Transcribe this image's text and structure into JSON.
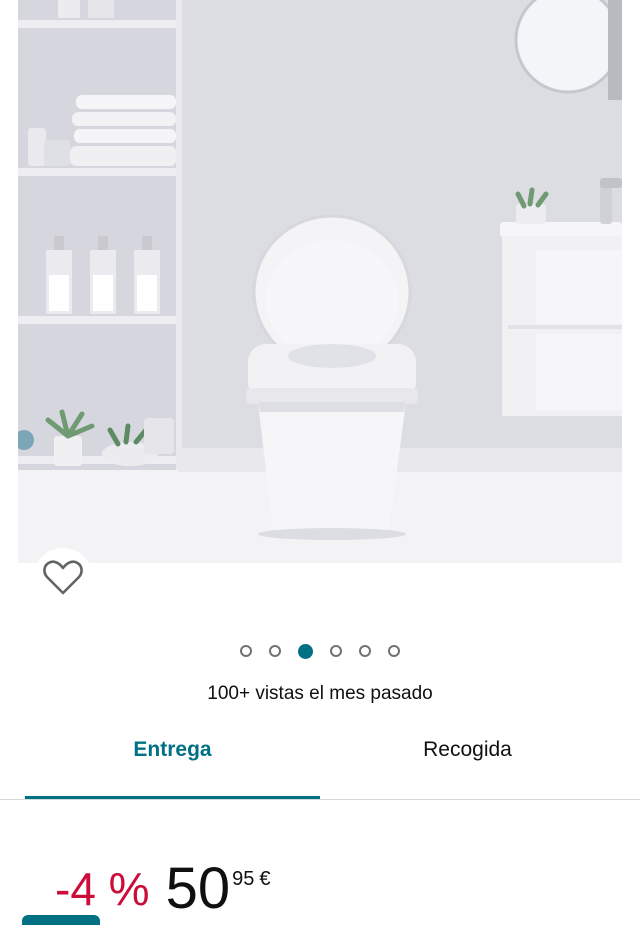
{
  "product": {
    "image_alt": "",
    "current_image_index": 3,
    "image_count": 6
  },
  "carousel": {
    "dots": [
      {
        "active": false
      },
      {
        "active": false
      },
      {
        "active": true
      },
      {
        "active": false
      },
      {
        "active": false
      },
      {
        "active": false
      }
    ]
  },
  "views_text": "100+ vistas el mes pasado",
  "tabs": [
    {
      "label": "Entrega",
      "selected": true
    },
    {
      "label": "Recogida",
      "selected": false
    }
  ],
  "price": {
    "discount": "-4 %",
    "whole": "50",
    "fraction": "95",
    "currency": "€"
  },
  "colors": {
    "accent": "#007185",
    "discount": "#cc0c39",
    "text": "#0f1111"
  },
  "icons": {
    "wishlist": "heart-outline-icon"
  }
}
